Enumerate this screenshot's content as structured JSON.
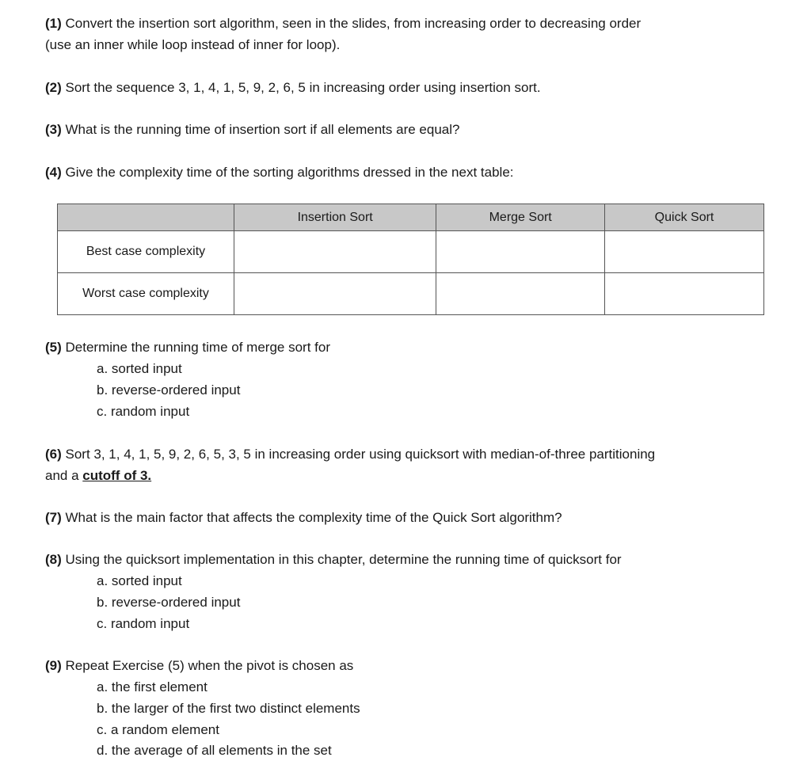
{
  "questions": {
    "q1": {
      "num": "(1)",
      "line1": " Convert the insertion sort algorithm, seen in the slides, from increasing order to decreasing order",
      "line2": "(use an inner while loop instead of inner for loop)."
    },
    "q2": {
      "num": "(2)",
      "text": " Sort the sequence 3, 1, 4, 1, 5, 9, 2, 6, 5 in increasing order using insertion sort."
    },
    "q3": {
      "num": "(3)",
      "text": " What is the running time of insertion sort if all elements are equal?"
    },
    "q4": {
      "num": "(4)",
      "text": " Give the complexity time of the sorting algorithms dressed in the next table:"
    },
    "q5": {
      "num": "(5)",
      "text": " Determine the running time of merge sort for",
      "items": [
        "a. sorted input",
        "b. reverse-ordered input",
        "c. random input"
      ]
    },
    "q6": {
      "num": "(6)",
      "line1": " Sort 3, 1, 4, 1, 5, 9, 2, 6, 5, 3, 5 in increasing order using quicksort with median-of-three partitioning",
      "line2_prefix": "and a ",
      "line2_emph": "cutoff of 3."
    },
    "q7": {
      "num": "(7)",
      "text": " What is the main factor that affects the complexity time of the Quick Sort algorithm?"
    },
    "q8": {
      "num": "(8)",
      "text": " Using the quicksort implementation in this chapter, determine the running time of quicksort for",
      "items": [
        "a. sorted input",
        "b. reverse-ordered input",
        "c. random input"
      ]
    },
    "q9": {
      "num": "(9)",
      "text": " Repeat Exercise (5) when the pivot is chosen as",
      "items": [
        "a. the first element",
        "b. the larger of the first two distinct elements",
        "c. a random element",
        "d. the average of all elements in the set"
      ]
    }
  },
  "table": {
    "header_bg": "#c8c8c8",
    "columns": [
      "",
      "Insertion Sort",
      "Merge Sort",
      "Quick Sort"
    ],
    "rows": [
      {
        "label": "Best case complexity",
        "cells": [
          "",
          "",
          ""
        ]
      },
      {
        "label": "Worst case complexity",
        "cells": [
          "",
          "",
          ""
        ]
      }
    ]
  }
}
